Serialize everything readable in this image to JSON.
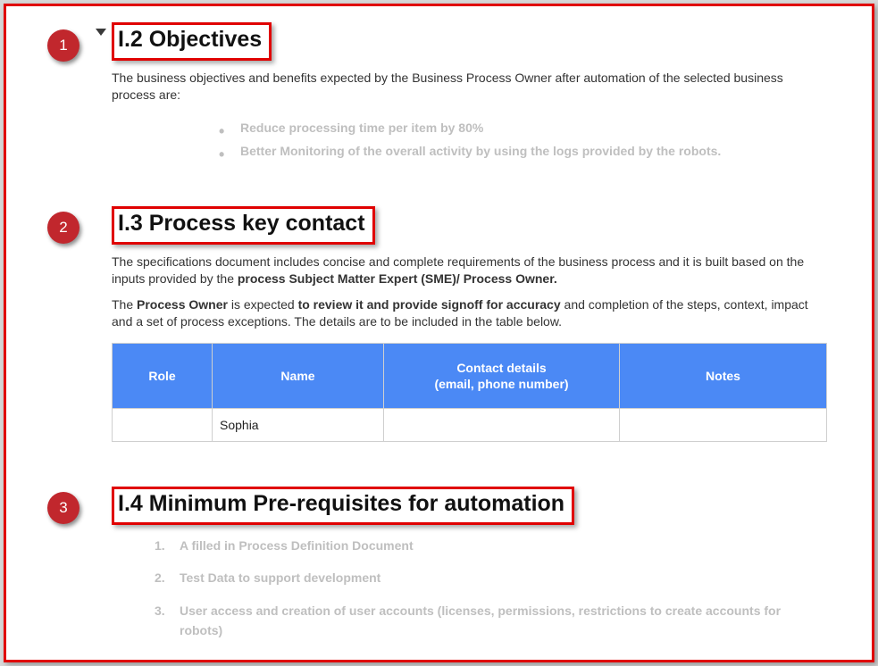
{
  "badges": {
    "b1": "1",
    "b2": "2",
    "b3": "3"
  },
  "sec1": {
    "heading": "I.2 Objectives",
    "intro": "The business objectives and benefits expected by the Business Process Owner after automation of the selected business process are:",
    "bullets": {
      "i0": "Reduce processing time per item by 80%",
      "i1": "Better Monitoring of the overall activity by using the logs provided by the robots."
    }
  },
  "sec2": {
    "heading": "I.3 Process key contact",
    "p1a": "The specifications document includes concise and complete requirements of the business process and it is built based on the inputs provided by the ",
    "p1b": "process Subject Matter Expert (SME)/ Process Owner.",
    "p2a": "The ",
    "p2b": "Process Owner",
    "p2c": " is expected ",
    "p2d": "to review it and provide signoff for accuracy",
    "p2e": " and completion of the steps, context, impact and a set of process exceptions. The details are to be included in the table below.",
    "table": {
      "headers": {
        "role": "Role",
        "name": "Name",
        "contact_l1": "Contact details",
        "contact_l2": "(email, phone number)",
        "notes": "Notes"
      },
      "row": {
        "role": "",
        "name": "Sophia",
        "contact": "",
        "notes": ""
      }
    }
  },
  "sec3": {
    "heading": "I.4 Minimum Pre-requisites for automation",
    "items": {
      "i0": "A filled in Process Definition Document",
      "i1": "Test Data to support development",
      "i2": "User access and creation of user accounts (licenses, permissions, restrictions to create accounts for robots)"
    }
  }
}
